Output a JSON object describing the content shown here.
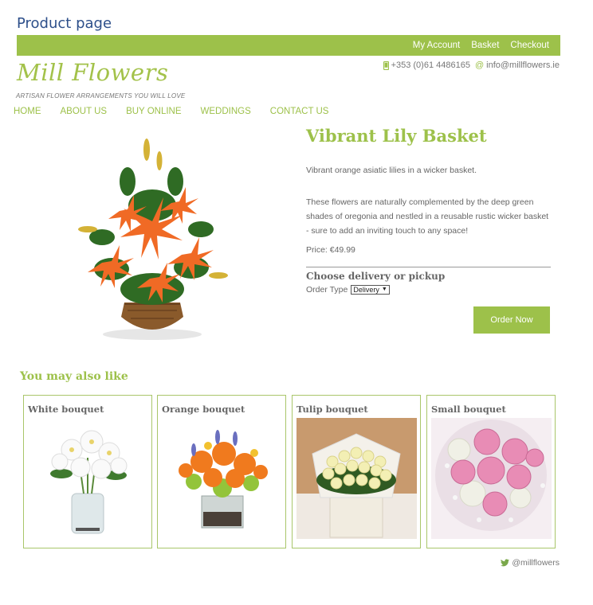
{
  "doc_label": "Product page",
  "topbar": {
    "links": [
      "My Account",
      "Basket",
      "Checkout"
    ]
  },
  "brand": {
    "logo": "Mill Flowers",
    "tagline": "ARTISAN FLOWER ARRANGEMENTS YOU WILL LOVE"
  },
  "contact": {
    "phone": "+353 (0)61 4486165",
    "email": "info@millflowers.ie",
    "phone_icon": "phone-icon",
    "email_icon": "at-icon"
  },
  "nav": [
    "HOME",
    "ABOUT US",
    "BUY ONLINE",
    "WEDDINGS",
    "CONTACT US"
  ],
  "product": {
    "title": "Vibrant Lily Basket",
    "summary": "Vibrant orange asiatic lilies in a wicker basket.",
    "description": "These flowers are naturally complemented by the deep green shades of oregonia and nestled in a reusable rustic wicker basket - sure to add an inviting touch to any space!",
    "price": "Price: €49.99",
    "delivery_heading": "Choose delivery or pickup",
    "order_type_label": "Order Type",
    "order_type_value": "Delivery",
    "order_button": "Order Now"
  },
  "related": {
    "heading": "You may also like",
    "items": [
      {
        "title": "White bouquet"
      },
      {
        "title": "Orange bouquet"
      },
      {
        "title": "Tulip bouquet"
      },
      {
        "title": "Small bouquet"
      }
    ]
  },
  "footer": {
    "handle": "@millflowers",
    "icon": "twitter-icon"
  },
  "colors": {
    "accent": "#9dc14a",
    "text": "#666666"
  }
}
